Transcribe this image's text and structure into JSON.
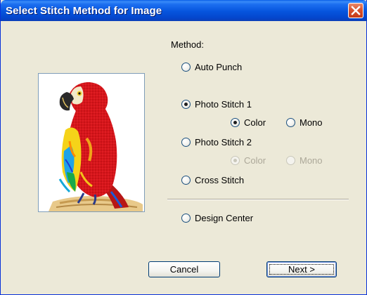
{
  "window": {
    "title": "Select Stitch Method for Image"
  },
  "method": {
    "label": "Method:",
    "options": [
      {
        "label": "Auto Punch",
        "selected": false,
        "enabled": true
      },
      {
        "label": "Photo Stitch 1",
        "selected": true,
        "enabled": true,
        "sub": [
          {
            "label": "Color",
            "selected": true,
            "enabled": true
          },
          {
            "label": "Mono",
            "selected": false,
            "enabled": true
          }
        ]
      },
      {
        "label": "Photo Stitch 2",
        "selected": false,
        "enabled": true,
        "sub": [
          {
            "label": "Color",
            "selected": true,
            "enabled": false
          },
          {
            "label": "Mono",
            "selected": false,
            "enabled": false
          }
        ]
      },
      {
        "label": "Cross Stitch",
        "selected": false,
        "enabled": true
      },
      {
        "label": "Design Center",
        "selected": false,
        "enabled": true
      }
    ]
  },
  "buttons": {
    "cancel": "Cancel",
    "next": "Next >"
  },
  "colors": {
    "titlebar": "#0654dd",
    "dialog_bg": "#ece9d8",
    "disabled_text": "#aca899"
  }
}
